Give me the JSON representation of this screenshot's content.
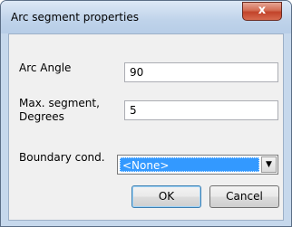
{
  "window": {
    "title": "Arc segment properties",
    "close_glyph": "x"
  },
  "form": {
    "arc_angle": {
      "label": "Arc Angle",
      "value": "90"
    },
    "max_segment": {
      "label_line1": "Max. segment,",
      "label_line2": "Degrees",
      "value": "5"
    },
    "boundary": {
      "label": "Boundary cond.",
      "selected": "<None>",
      "arrow_icon": "chevron-down-icon"
    }
  },
  "buttons": {
    "ok": "OK",
    "cancel": "Cancel"
  },
  "colors": {
    "selection": "#3399ff",
    "close": "#c2432a"
  }
}
